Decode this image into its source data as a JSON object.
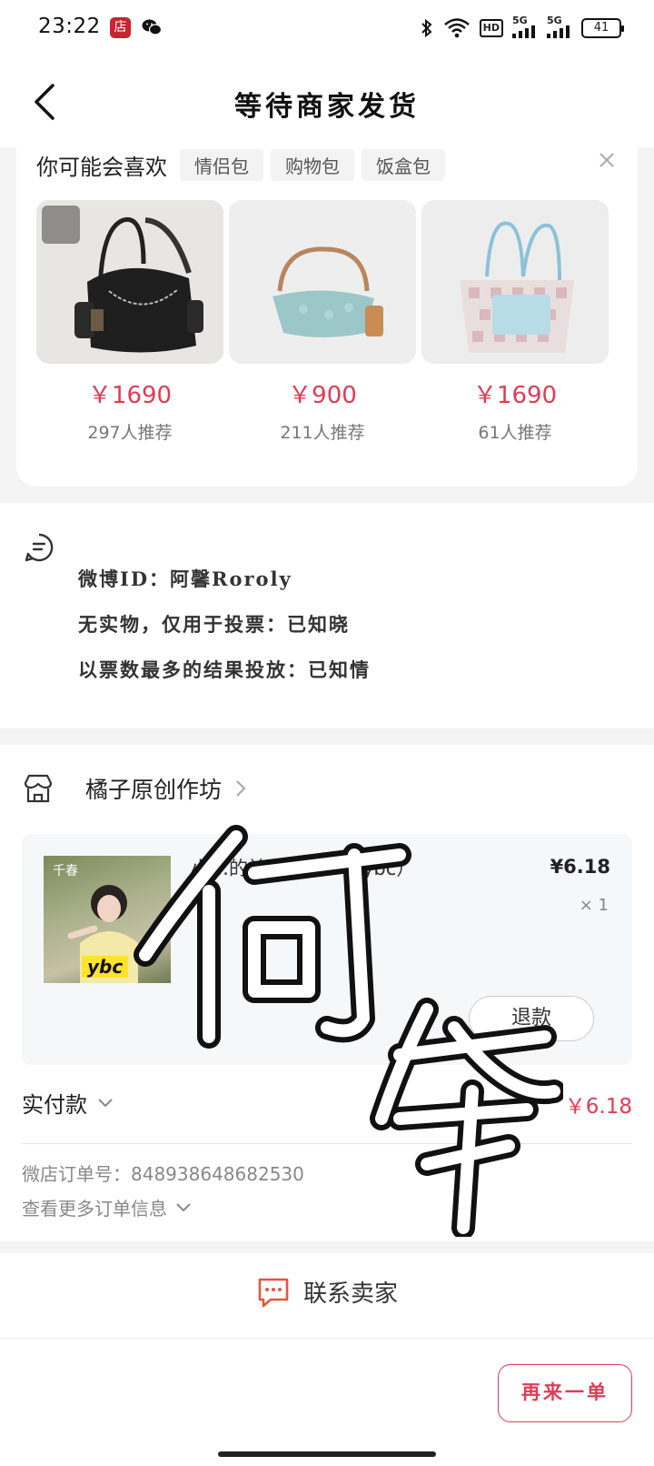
{
  "status_bar": {
    "time": "23:22",
    "shop_badge": "店",
    "hd": "HD",
    "net1": "5G",
    "net2": "5G",
    "battery": "41"
  },
  "nav": {
    "title": "等待商家发货"
  },
  "recommend": {
    "title": "你可能会喜欢",
    "tags": [
      "情侣包",
      "购物包",
      "饭盒包"
    ],
    "products": [
      {
        "price": "￥1690",
        "count": "297人推荐"
      },
      {
        "price": "￥900",
        "count": "211人推荐"
      },
      {
        "price": "￥1690",
        "count": "61人推荐"
      }
    ]
  },
  "note": {
    "lines": [
      "微博ID：阿馨Roroly",
      "无实物，仅用于投票：已知晓",
      "以票数最多的结果投放：已知情"
    ]
  },
  "order": {
    "shop_name": "橘子原创作坊",
    "item": {
      "title": "小…的神秘问卷一（ybc）",
      "price": "¥6.18",
      "qty": "× 1",
      "thumb_label": "ybc",
      "thumb_brand": "千春",
      "refund_label": "退款"
    },
    "paid_label": "实付款",
    "paid_value": "￥6.18",
    "order_no": "微店订单号：848938648682530",
    "more_info": "查看更多订单信息"
  },
  "contact": {
    "label": "联系卖家"
  },
  "bottom": {
    "reorder_label": "再来一单"
  },
  "colors": {
    "accent": "#e23b55",
    "shop_badge": "#c8252f"
  }
}
